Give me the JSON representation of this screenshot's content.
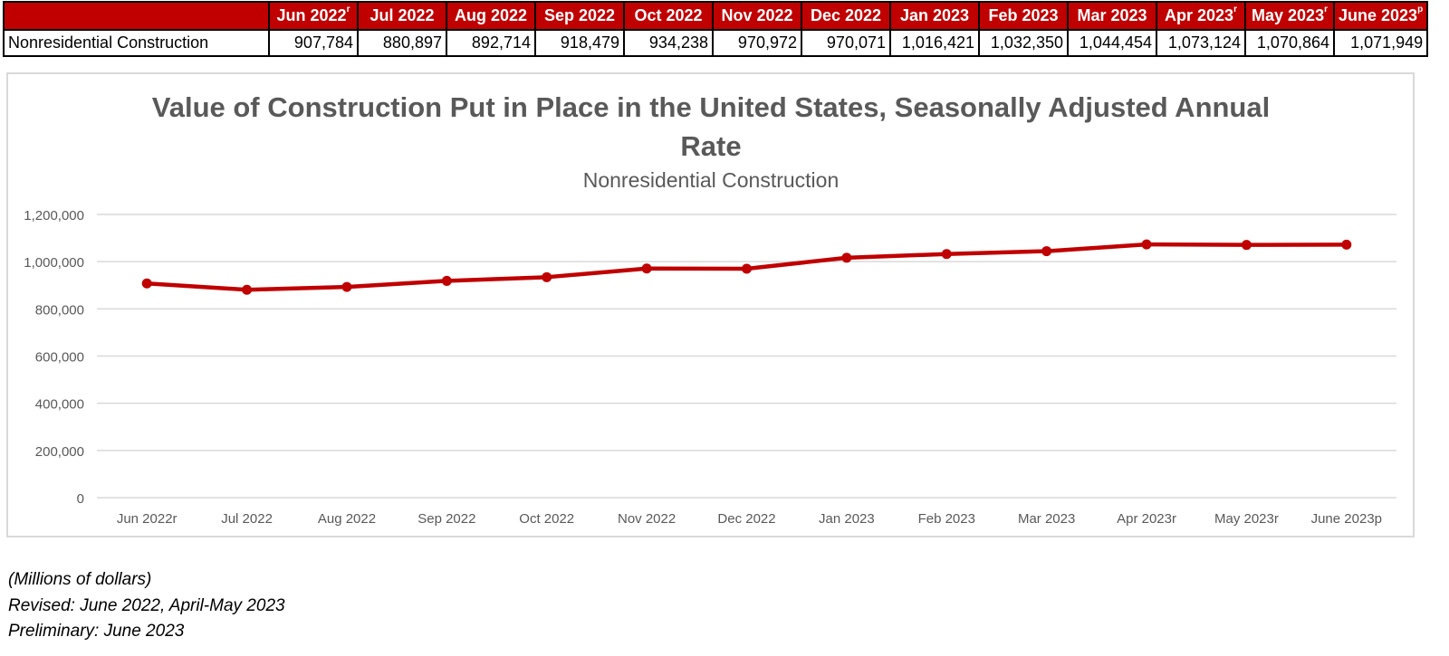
{
  "table": {
    "row_label": "Nonresidential Construction",
    "headers": [
      {
        "label": "Jun 2022",
        "sup": "r"
      },
      {
        "label": "Jul 2022",
        "sup": ""
      },
      {
        "label": "Aug 2022",
        "sup": ""
      },
      {
        "label": "Sep 2022",
        "sup": ""
      },
      {
        "label": "Oct 2022",
        "sup": ""
      },
      {
        "label": "Nov 2022",
        "sup": ""
      },
      {
        "label": "Dec 2022",
        "sup": ""
      },
      {
        "label": "Jan 2023",
        "sup": ""
      },
      {
        "label": "Feb 2023",
        "sup": ""
      },
      {
        "label": "Mar 2023",
        "sup": ""
      },
      {
        "label": "Apr 2023",
        "sup": "r"
      },
      {
        "label": "May 2023",
        "sup": "r"
      },
      {
        "label": "June 2023",
        "sup": "p"
      }
    ],
    "values": [
      "907,784",
      "880,897",
      "892,714",
      "918,479",
      "934,238",
      "970,972",
      "970,071",
      "1,016,421",
      "1,032,350",
      "1,044,454",
      "1,073,124",
      "1,070,864",
      "1,071,949"
    ]
  },
  "colors": {
    "header_bg": "#c00000",
    "line": "#c00000",
    "grid": "#d9d9d9",
    "axis_text": "#595959",
    "title_text": "#595959"
  },
  "chart_data": {
    "type": "line",
    "title": "Value of Construction Put in Place in the United States, Seasonally Adjusted Annual Rate",
    "title_lines": [
      "Value of Construction Put in Place in the United States, Seasonally Adjusted Annual",
      "Rate"
    ],
    "subtitle": "Nonresidential Construction",
    "xlabel": "",
    "ylabel": "",
    "categories": [
      "Jun 2022r",
      "Jul 2022",
      "Aug 2022",
      "Sep 2022",
      "Oct 2022",
      "Nov 2022",
      "Dec 2022",
      "Jan 2023",
      "Feb 2023",
      "Mar 2023",
      "Apr 2023r",
      "May 2023r",
      "June 2023p"
    ],
    "series": [
      {
        "name": "Nonresidential Construction",
        "values": [
          907784,
          880897,
          892714,
          918479,
          934238,
          970972,
          970071,
          1016421,
          1032350,
          1044454,
          1073124,
          1070864,
          1071949
        ]
      }
    ],
    "ylim": [
      0,
      1200000
    ],
    "yticks": [
      0,
      200000,
      400000,
      600000,
      800000,
      1000000,
      1200000
    ],
    "ytick_labels": [
      "0",
      "200,000",
      "400,000",
      "600,000",
      "800,000",
      "1,000,000",
      "1,200,000"
    ],
    "grid": true,
    "legend": "none",
    "markers": true
  },
  "notes": [
    "(Millions of dollars)",
    "Revised:  June 2022, April-May 2023",
    "Preliminary: June 2023"
  ]
}
